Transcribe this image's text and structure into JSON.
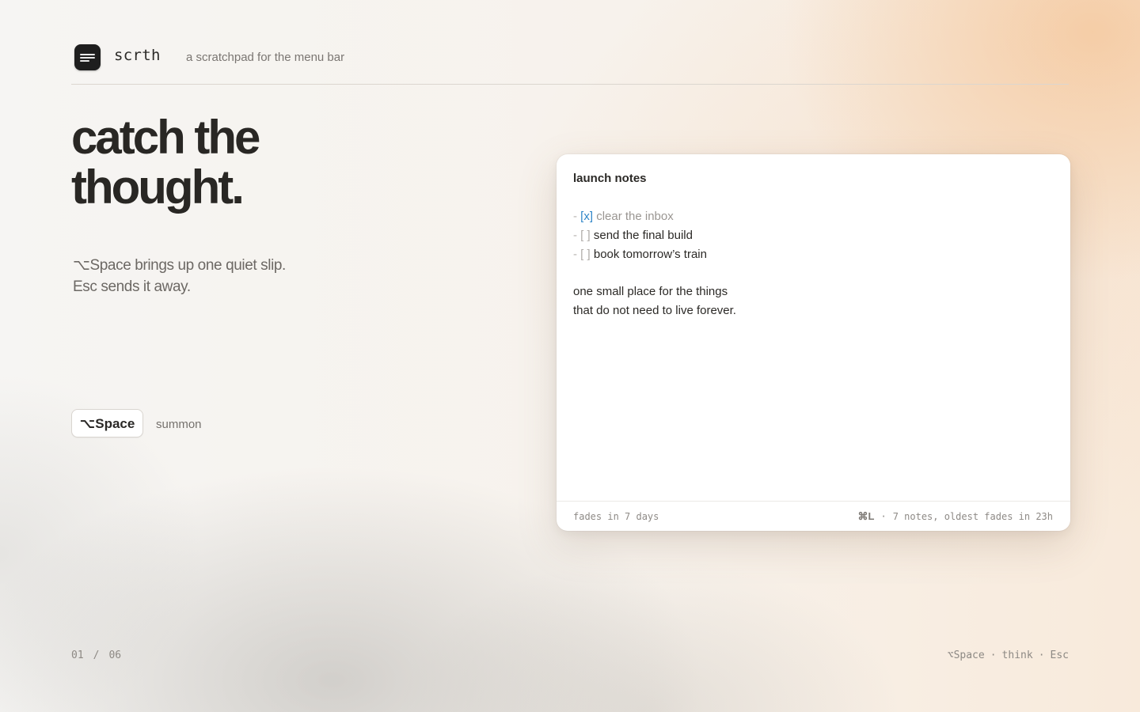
{
  "header": {
    "app_name": "scrth",
    "tagline": "a scratchpad for the menu bar",
    "logo_icon": "notes-icon"
  },
  "hero": {
    "headline_line1": "catch the",
    "headline_line2": "thought.",
    "sub_line1": "⌥Space brings up one quiet slip.",
    "sub_line2": "Esc sends it away."
  },
  "shortcut": {
    "key": "⌥Space",
    "label": "summon"
  },
  "note": {
    "title": "launch notes",
    "tasks": [
      {
        "dash": "-",
        "box": "[x]",
        "text": "clear the inbox",
        "done": true
      },
      {
        "dash": "-",
        "box": "[ ]",
        "text": "send the final build",
        "done": false
      },
      {
        "dash": "-",
        "box": "[ ]",
        "text": "book tomorrow’s train",
        "done": false
      }
    ],
    "body_line1": "one small place for the things",
    "body_line2": "that do not need to live forever.",
    "footer": {
      "fade": "fades in 7 days",
      "shortcut": "⌘L",
      "sep": "·",
      "status": "7 notes, oldest fades in 23h"
    }
  },
  "pager": {
    "current": "01",
    "sep": "/",
    "total": "06"
  },
  "hints": {
    "k1": "⌥Space",
    "k2": "think",
    "k3": "Esc",
    "dot": "·"
  },
  "colors": {
    "accent_done_box": "#2f86c8",
    "headline": "#292724",
    "logo_bg": "#1e1e1e"
  }
}
